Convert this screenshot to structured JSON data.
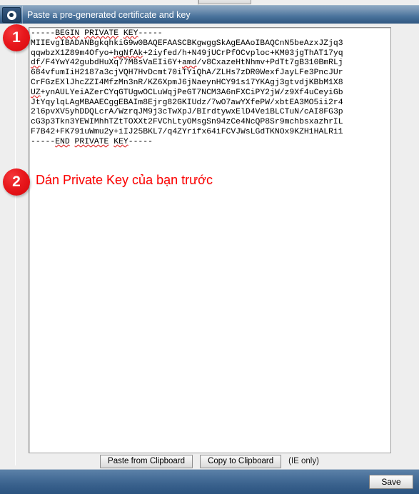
{
  "window": {
    "title": "Paste a pre-generated certificate and key",
    "icon": "certificate-radio-icon"
  },
  "theme": {
    "header_gradient_top": "#8ba7c2",
    "header_gradient_bottom": "#2f5680",
    "footer_gradient_top": "#5d82a8",
    "footer_gradient_bottom": "#2c5480",
    "annotation_red": "#ff0000",
    "badge_red": "#e8181d",
    "page_background": "#eeeeee",
    "textarea_background": "#ffffff"
  },
  "key_editor": {
    "name": "private-key-textarea",
    "placeholder": "Paste a pre-generated certificate and key",
    "value": "-----BEGIN PRIVATE KEY-----\nMIIEvgIBADANBgkqhkiG9w0BAQEFAASCBKgwggSkAgEAAoIBAQCnN5beAzxJZjq3\nqqwbzX1Z89m4Ofyo+hgNfAk+2iyfed/h+N49jUCrPfOCvploc+KM03jgThAT17yq\ndf/F4YwY42gubdHuXq77M8sVaEIi6Y+amd/v8CxazeHtNhmv+PdTt7gB310BmRLj\n684vfumIiH2187a3cjVQH7HvDcmt70iTYiQhA/ZLHs7zDR0WexfJayLFe3PncJUr\nCrFGzEXlJhcZZI4MfzMn3nR/KZ6XpmJ6jNaeynHCY91s17YKAgj3gtvdjKBbM1X8\nUZ+ynAULYeiAZerCYqGTUgwOCLuWqjPeGT7NCM3A6nFXCiPY2jW/z9Xf4uCeyiGb\nJtYqylqLAgMBAAECggEBAIm8Ejrg82GKIUdz/7wO7awYXfePW/xbtEA3MO5ii2r4\n2l6pvXV5yhDDQLcrA/WzrqJM9j3cTwXpJ/BIrdtywxElD4Ve1BLCTuN/cAI8FG3p\ncG3p3Tkn3YEWIMhhTZtTOXXt2FVChLtyOMsgSn94zCe4NcQP8Sr9mchbsxazhrIL\nF7B42+FK791uWmu2y+iIJ25BKL7/q4ZYrifx64iFCVJWsLGdTKNOx9KZH1HALRi1\n-----END PRIVATE KEY-----",
    "spellcheck_words": [
      "BEGIN",
      "PRIVATE",
      "KEY",
      "hgNfAk",
      "df",
      "amd",
      "UZ",
      "END"
    ]
  },
  "annotations": [
    {
      "number": "1",
      "name": "step-1-badge",
      "target": "private-key-textarea"
    },
    {
      "number": "2",
      "name": "step-2-badge",
      "text": "Dán Private Key của bạn trước"
    }
  ],
  "toolbar": {
    "paste_from_clipboard_label": "Paste from Clipboard",
    "copy_to_clipboard_label": "Copy to Clipboard",
    "ie_only_note": "(IE only)"
  },
  "footer": {
    "save_label": "Save"
  }
}
